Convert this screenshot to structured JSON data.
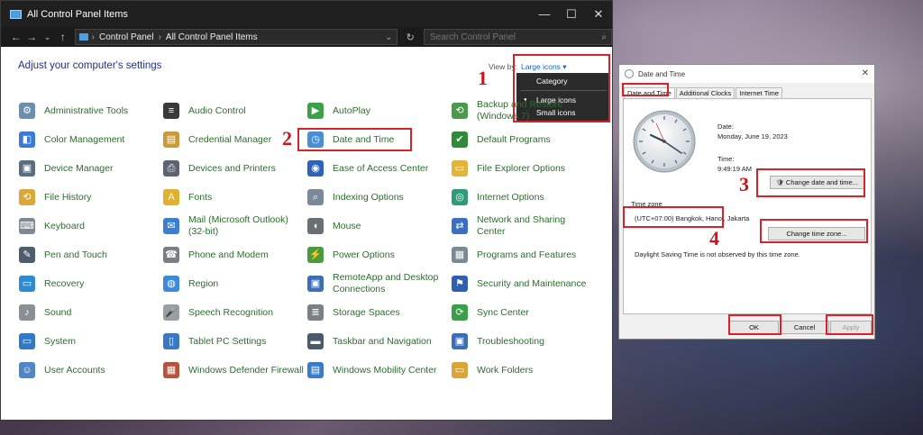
{
  "window": {
    "title": "All Control Panel Items",
    "controls": {
      "minimize": "—",
      "maximize": "☐",
      "close": "✕"
    }
  },
  "navbar": {
    "back": "←",
    "forward": "→",
    "recent": "⌄",
    "up": "↑",
    "breadcrumb": [
      "Control Panel",
      "All Control Panel Items"
    ],
    "separator": "›",
    "dropdown": "⌄",
    "refresh": "↻",
    "search_placeholder": "Search Control Panel",
    "search_icon": "⌕"
  },
  "heading": "Adjust your computer's settings",
  "view_by": {
    "label": "View by:",
    "value": "Large icons ▾",
    "options": [
      "Category",
      "Large icons",
      "Small icons"
    ],
    "selected_bullet": "●"
  },
  "items": [
    {
      "label": "Administrative Tools",
      "icon": "admin-tools-icon",
      "color": "#6c8fb0",
      "glyph": "⚙"
    },
    {
      "label": "Color Management",
      "icon": "color-management-icon",
      "color": "#3b7bd6",
      "glyph": "◧"
    },
    {
      "label": "Device Manager",
      "icon": "device-manager-icon",
      "color": "#5a6d80",
      "glyph": "▣"
    },
    {
      "label": "File History",
      "icon": "file-history-icon",
      "color": "#d9a73a",
      "glyph": "⟲"
    },
    {
      "label": "Keyboard",
      "icon": "keyboard-icon",
      "color": "#7d8a96",
      "glyph": "⌨"
    },
    {
      "label": "Pen and Touch",
      "icon": "pen-touch-icon",
      "color": "#4d5d6d",
      "glyph": "✎"
    },
    {
      "label": "Recovery",
      "icon": "recovery-icon",
      "color": "#2f8ad0",
      "glyph": "▭"
    },
    {
      "label": "Sound",
      "icon": "sound-icon",
      "color": "#8a8f95",
      "glyph": "♪"
    },
    {
      "label": "System",
      "icon": "system-icon",
      "color": "#3178c6",
      "glyph": "▭"
    },
    {
      "label": "User Accounts",
      "icon": "user-accounts-icon",
      "color": "#4f86c6",
      "glyph": "☺"
    },
    {
      "label": "Audio Control",
      "icon": "audio-control-icon",
      "color": "#3a3a3a",
      "glyph": "≡"
    },
    {
      "label": "Credential Manager",
      "icon": "credential-manager-icon",
      "color": "#c99a3a",
      "glyph": "▤"
    },
    {
      "label": "Devices and Printers",
      "icon": "devices-printers-icon",
      "color": "#5b6470",
      "glyph": "⎙"
    },
    {
      "label": "Fonts",
      "icon": "fonts-icon",
      "color": "#e0b030",
      "glyph": "A"
    },
    {
      "label": "Mail (Microsoft Outlook) (32-bit)",
      "icon": "mail-icon",
      "color": "#3a7fd0",
      "glyph": "✉"
    },
    {
      "label": "Phone and Modem",
      "icon": "phone-modem-icon",
      "color": "#7a7f85",
      "glyph": "☎"
    },
    {
      "label": "Region",
      "icon": "region-icon",
      "color": "#3c8ad8",
      "glyph": "◍"
    },
    {
      "label": "Speech Recognition",
      "icon": "speech-recognition-icon",
      "color": "#9a9fa5",
      "glyph": "🎤"
    },
    {
      "label": "Tablet PC Settings",
      "icon": "tablet-pc-icon",
      "color": "#3a78c4",
      "glyph": "▯"
    },
    {
      "label": "Windows Defender Firewall",
      "icon": "firewall-icon",
      "color": "#b5533c",
      "glyph": "▦"
    },
    {
      "label": "AutoPlay",
      "icon": "autoplay-icon",
      "color": "#3aa04a",
      "glyph": "▶"
    },
    {
      "label": "Date and Time",
      "icon": "date-time-icon",
      "color": "#4a8fd6",
      "glyph": "◷"
    },
    {
      "label": "Ease of Access Center",
      "icon": "ease-of-access-icon",
      "color": "#2f63b8",
      "glyph": "◉"
    },
    {
      "label": "Indexing Options",
      "icon": "indexing-options-icon",
      "color": "#7a8a99",
      "glyph": "⌕"
    },
    {
      "label": "Mouse",
      "icon": "mouse-icon",
      "color": "#6a6f75",
      "glyph": "◖"
    },
    {
      "label": "Power Options",
      "icon": "power-options-icon",
      "color": "#4a9a3e",
      "glyph": "⚡"
    },
    {
      "label": "RemoteApp and Desktop Connections",
      "icon": "remoteapp-icon",
      "color": "#3a6fb8",
      "glyph": "▣"
    },
    {
      "label": "Storage Spaces",
      "icon": "storage-spaces-icon",
      "color": "#7b8087",
      "glyph": "≣"
    },
    {
      "label": "Taskbar and Navigation",
      "icon": "taskbar-icon",
      "color": "#4a5a6a",
      "glyph": "▬"
    },
    {
      "label": "Windows Mobility Center",
      "icon": "mobility-center-icon",
      "color": "#3b7cc9",
      "glyph": "▤"
    },
    {
      "label": "Backup and Restore (Windows 7)",
      "icon": "backup-restore-icon",
      "color": "#4b9a4b",
      "glyph": "⟲"
    },
    {
      "label": "Default Programs",
      "icon": "default-programs-icon",
      "color": "#2f8a3a",
      "glyph": "✔"
    },
    {
      "label": "File Explorer Options",
      "icon": "file-explorer-options-icon",
      "color": "#e2b43a",
      "glyph": "▭"
    },
    {
      "label": "Internet Options",
      "icon": "internet-options-icon",
      "color": "#2e9a7a",
      "glyph": "◎"
    },
    {
      "label": "Network and Sharing Center",
      "icon": "network-sharing-icon",
      "color": "#3b6fc0",
      "glyph": "⇄"
    },
    {
      "label": "Programs and Features",
      "icon": "programs-features-icon",
      "color": "#7a8a95",
      "glyph": "▦"
    },
    {
      "label": "Security and Maintenance",
      "icon": "security-maintenance-icon",
      "color": "#2f5fb0",
      "glyph": "⚑"
    },
    {
      "label": "Sync Center",
      "icon": "sync-center-icon",
      "color": "#3aa048",
      "glyph": "⟳"
    },
    {
      "label": "Troubleshooting",
      "icon": "troubleshooting-icon",
      "color": "#3a6fb8",
      "glyph": "▣"
    },
    {
      "label": "Work Folders",
      "icon": "work-folders-icon",
      "color": "#d9a53a",
      "glyph": "▭"
    }
  ],
  "annotations": [
    "1",
    "2",
    "3",
    "4"
  ],
  "dialog": {
    "title": "Date and Time",
    "close": "✕",
    "tabs": [
      "Date and Time",
      "Additional Clocks",
      "Internet Time"
    ],
    "date_label": "Date:",
    "date_value": "Monday, June 19, 2023",
    "time_label": "Time:",
    "time_value": "9:49:19 AM",
    "change_datetime_button": "Change date and time...",
    "shield_icon": "🛡",
    "timezone_section": "Time zone",
    "timezone_value": "(UTC+07:00) Bangkok, Hanoi, Jakarta",
    "change_timezone_button": "Change time zone...",
    "dst_note": "Daylight Saving Time is not observed by this time zone.",
    "ok_button": "OK",
    "cancel_button": "Cancel",
    "apply_button": "Apply"
  }
}
